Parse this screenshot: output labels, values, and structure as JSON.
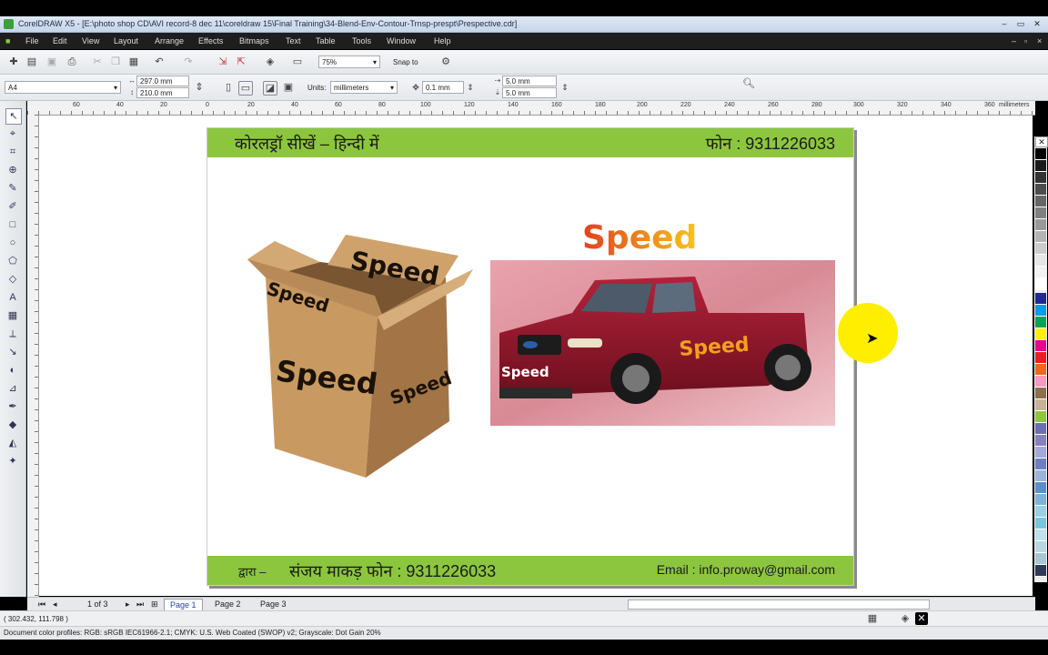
{
  "window": {
    "title": "CorelDRAW X5 - [E:\\photo shop CD\\AVI record-8 dec 11\\coreldraw 15\\Final Training\\34-Blend-Env-Contour-Trnsp-prespt\\Prespective.cdr]"
  },
  "menu": [
    "File",
    "Edit",
    "View",
    "Layout",
    "Arrange",
    "Effects",
    "Bitmaps",
    "Text",
    "Table",
    "Tools",
    "Window",
    "Help"
  ],
  "toolbar": {
    "zoom": "75%",
    "snap_to": "Snap to"
  },
  "property_bar": {
    "paper_size": "A4",
    "width": "297.0 mm",
    "height": "210.0 mm",
    "units_label": "Units:",
    "units_value": "millimeters",
    "nudge": "0.1 mm",
    "dup_x": "5.0 mm",
    "dup_y": "5.0 mm"
  },
  "ruler": {
    "top_ticks": [
      "60",
      "40",
      "20",
      "0",
      "20",
      "40",
      "60",
      "80",
      "100",
      "120",
      "140",
      "160",
      "180",
      "200",
      "220",
      "240",
      "260",
      "280",
      "300",
      "320",
      "340",
      "360"
    ],
    "unit": "millimeters"
  },
  "design": {
    "header_left": "कोरलड्रॉ सीखें – हिन्दी में",
    "header_right": "फोन : 9311226033",
    "footer_left_prefix": "द्वारा –",
    "footer_left": "संजय माकड़ फोन : 9311226033",
    "footer_right": "Email : info.proway@gmail.com",
    "speed_title": "Speed",
    "box_top": "Speed",
    "box_flap": "Speed",
    "box_front": "Speed",
    "box_side": "Speed",
    "car_side": "Speed",
    "car_front": "Speed"
  },
  "pages": {
    "count_text": "1 of 3",
    "tabs": [
      "Page 1",
      "Page 2",
      "Page 3"
    ]
  },
  "status": {
    "coords": "( 302.432, 111.798 )",
    "profiles": "Document color profiles: RGB: sRGB IEC61966-2.1; CMYK: U.S. Web Coated (SWOP) v2; Grayscale: Dot Gain 20%"
  },
  "colors": {
    "band": "#8cc63f",
    "menubar": "#1e1e1e",
    "cursor_highlight": "#ffee00"
  }
}
